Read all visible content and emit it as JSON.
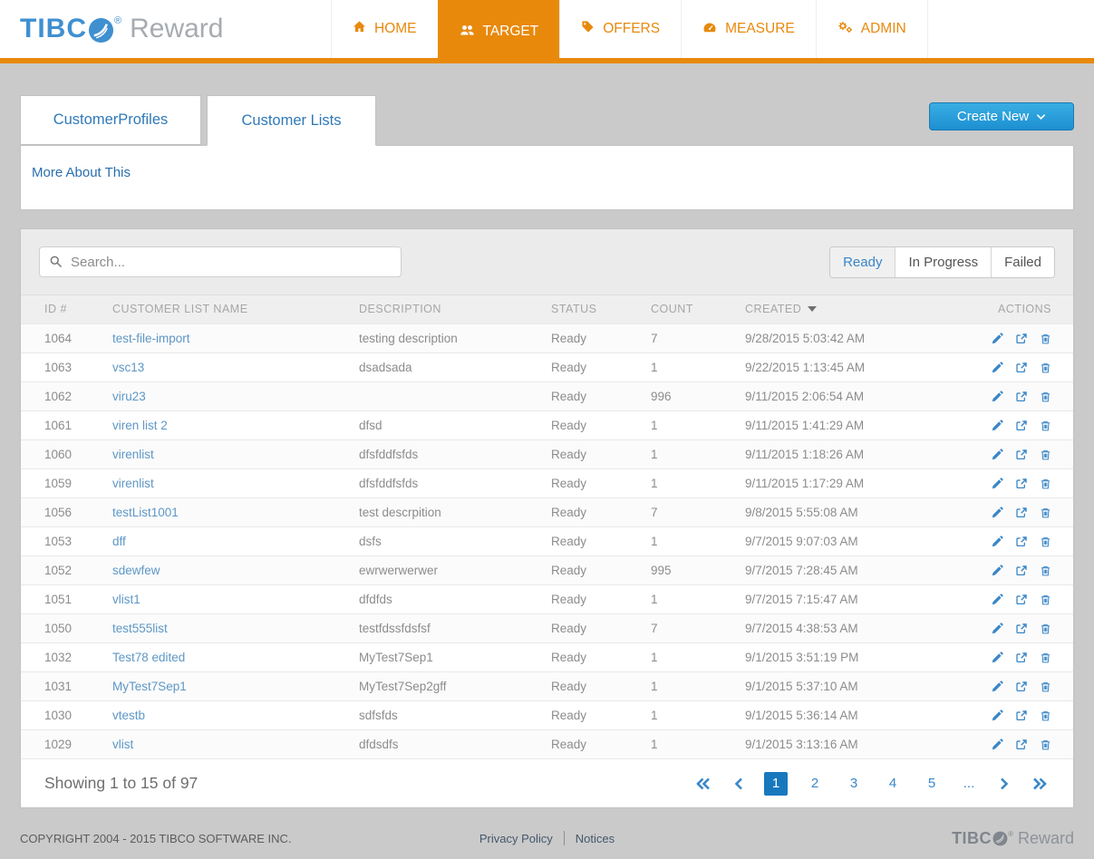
{
  "brand": {
    "name_primary": "TIBC",
    "registered_mark": "®",
    "name_secondary": "Reward"
  },
  "nav": {
    "items": [
      {
        "label": "HOME",
        "icon": "home-icon",
        "active": false
      },
      {
        "label": "TARGET",
        "icon": "users-icon",
        "active": true
      },
      {
        "label": "OFFERS",
        "icon": "tag-icon",
        "active": false
      },
      {
        "label": "MEASURE",
        "icon": "gauge-icon",
        "active": false
      },
      {
        "label": "ADMIN",
        "icon": "cogs-icon",
        "active": false
      }
    ]
  },
  "tabs": [
    {
      "label": "CustomerProfiles",
      "active": false
    },
    {
      "label": "Customer Lists",
      "active": true
    }
  ],
  "create_new": {
    "label": "Create New"
  },
  "more_about": {
    "label": "More About This"
  },
  "search": {
    "placeholder": "Search..."
  },
  "filters": [
    {
      "label": "Ready",
      "active": true
    },
    {
      "label": "In Progress",
      "active": false
    },
    {
      "label": "Failed",
      "active": false
    }
  ],
  "table": {
    "columns": {
      "id": "ID #",
      "name": "CUSTOMER LIST NAME",
      "description": "DESCRIPTION",
      "status": "STATUS",
      "count": "COUNT",
      "created": "CREATED",
      "actions": "ACTIONS"
    },
    "sorted_by": "CREATED",
    "sort_direction": "desc",
    "rows": [
      {
        "id": "1064",
        "name": "test-file-import",
        "description": "testing description",
        "status": "Ready",
        "count": "7",
        "created": "9/28/2015 5:03:42 AM"
      },
      {
        "id": "1063",
        "name": "vsc13",
        "description": "dsadsada",
        "status": "Ready",
        "count": "1",
        "created": "9/22/2015 1:13:45 AM"
      },
      {
        "id": "1062",
        "name": "viru23",
        "description": "",
        "status": "Ready",
        "count": "996",
        "created": "9/11/2015 2:06:54 AM"
      },
      {
        "id": "1061",
        "name": "viren list 2",
        "description": "dfsd",
        "status": "Ready",
        "count": "1",
        "created": "9/11/2015 1:41:29 AM"
      },
      {
        "id": "1060",
        "name": "virenlist",
        "description": "dfsfddfsfds",
        "status": "Ready",
        "count": "1",
        "created": "9/11/2015 1:18:26 AM"
      },
      {
        "id": "1059",
        "name": "virenlist",
        "description": "dfsfddfsfds",
        "status": "Ready",
        "count": "1",
        "created": "9/11/2015 1:17:29 AM"
      },
      {
        "id": "1056",
        "name": "testList1001",
        "description": "test descrpition",
        "status": "Ready",
        "count": "7",
        "created": "9/8/2015 5:55:08 AM"
      },
      {
        "id": "1053",
        "name": "dff",
        "description": "dsfs",
        "status": "Ready",
        "count": "1",
        "created": "9/7/2015 9:07:03 AM"
      },
      {
        "id": "1052",
        "name": "sdewfew",
        "description": "ewrwerwerwer",
        "status": "Ready",
        "count": "995",
        "created": "9/7/2015 7:28:45 AM"
      },
      {
        "id": "1051",
        "name": "vlist1",
        "description": "dfdfds",
        "status": "Ready",
        "count": "1",
        "created": "9/7/2015 7:15:47 AM"
      },
      {
        "id": "1050",
        "name": "test555list",
        "description": "testfdssfdsfsf",
        "status": "Ready",
        "count": "7",
        "created": "9/7/2015 4:38:53 AM"
      },
      {
        "id": "1032",
        "name": "Test78 edited",
        "description": "MyTest7Sep1",
        "status": "Ready",
        "count": "1",
        "created": "9/1/2015 3:51:19 PM"
      },
      {
        "id": "1031",
        "name": "MyTest7Sep1",
        "description": "MyTest7Sep2gff",
        "status": "Ready",
        "count": "1",
        "created": "9/1/2015 5:37:10 AM"
      },
      {
        "id": "1030",
        "name": "vtestb",
        "description": "sdfsfds",
        "status": "Ready",
        "count": "1",
        "created": "9/1/2015 5:36:14 AM"
      },
      {
        "id": "1029",
        "name": "vlist",
        "description": "dfdsdfs",
        "status": "Ready",
        "count": "1",
        "created": "9/1/2015 3:13:16 AM"
      }
    ],
    "row_actions": [
      "edit",
      "open",
      "delete"
    ]
  },
  "pagination": {
    "summary": "Showing 1 to 15 of 97",
    "pages": [
      "1",
      "2",
      "3",
      "4",
      "5",
      "..."
    ],
    "active_page": "1"
  },
  "footer": {
    "copyright": "COPYRIGHT 2004 - 2015 TIBCO SOFTWARE INC.",
    "links": [
      {
        "label": "Privacy Policy"
      },
      {
        "label": "Notices"
      }
    ]
  },
  "colors": {
    "accent_orange": "#e8890c",
    "link_blue": "#2a6fae",
    "row_link_blue": "#5e97c6",
    "button_blue_top": "#39aee3",
    "button_blue_bottom": "#1d8fd1",
    "pagination_active": "#1878be",
    "page_background": "#cacaca"
  }
}
